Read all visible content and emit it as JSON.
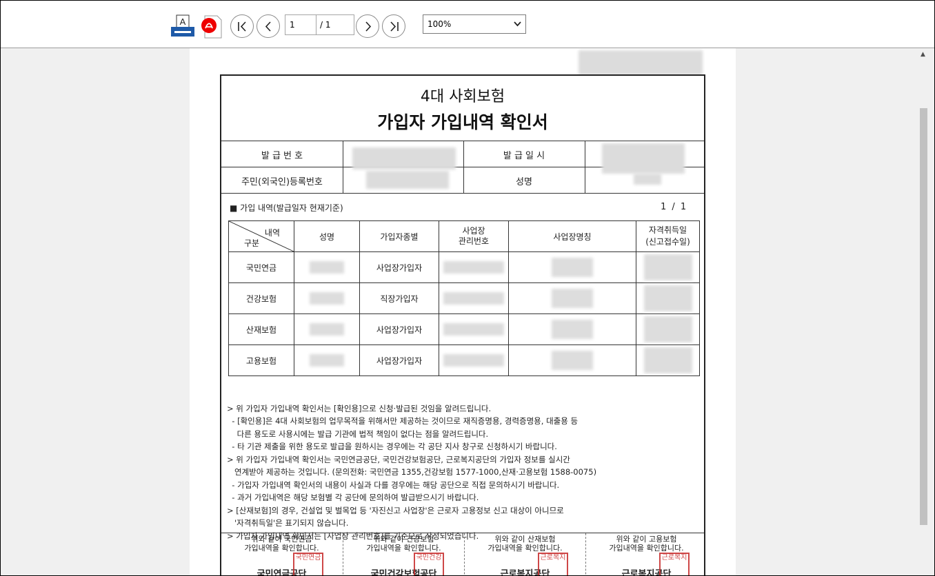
{
  "toolbar": {
    "page_current": "1",
    "page_total": "/ 1",
    "zoom": "100%",
    "icons": [
      "print-text-icon",
      "pdf-icon",
      "first-page-icon",
      "prev-page-icon",
      "next-page-icon",
      "last-page-icon"
    ]
  },
  "doc": {
    "title_line1": "4대 사회보험",
    "title_line2": "가입자 가입내역 확인서",
    "issue_no_label": "발 급 번 호",
    "issue_date_label": "발 급 일 시",
    "reg_no_label": "주민(외국인)등록번호",
    "name_label": "성명",
    "section_title": "■ 가입 내역(발급일자 현재기준)",
    "page_indicator": "1 / 1",
    "table": {
      "corner_top": "내역",
      "corner_bottom": "구분",
      "headers": [
        "성명",
        "가입자종별",
        "사업장\n관리번호",
        "사업장명칭",
        "자격취득일\n(신고접수일)"
      ],
      "rows": [
        {
          "category": "국민연금",
          "type": "사업장가입자"
        },
        {
          "category": "건강보험",
          "type": "직장가입자"
        },
        {
          "category": "산재보험",
          "type": "사업장가입자"
        },
        {
          "category": "고용보험",
          "type": "사업장가입자"
        }
      ]
    },
    "notes": [
      "> 위 가입자 가입내역 확인서는 [확인용]으로 신청·발급된 것임을 알려드립니다.",
      "  - [확인용]은 4대 사회보험의 업무목적을 위해서만 제공하는 것이므로 재직증명용, 경력증명용, 대출용 등",
      "    다른 용도로 사용시에는 발급 기관에 법적 책임이 없다는 점을 알려드립니다.",
      "  - 타 기관 제출을 위한 용도로 발급을 원하시는 경우에는 각 공단 지사 창구로 신청하시기 바랍니다.",
      "> 위 가입자 가입내역 확인서는 국민연금공단, 국민건강보험공단, 근로복지공단의 가입자 정보를 실시간",
      "   연계받아 제공하는 것입니다. (문의전화: 국민연금 1355,건강보험 1577-1000,산재·고용보험 1588-0075)",
      "  - 가입자 가입내역 확인서의 내용이 사실과 다를 경우에는 해당 공단으로 직접 문의하시기 바랍니다.",
      "  - 과거 가입내역은 해당 보험별 각 공단에 문의하여 발급받으시기 바랍니다.",
      "> [산재보험]의 경우, 건설업 및 벌목업 등 '자진신고 사업장'은 근로자 고용정보 신고 대상이 아니므로",
      "   '자격취득일'은 표기되지 않습니다.",
      "> 가입자 가입내역 확인서는 [사업장 관리번호]를 기준으로 작성되었습니다."
    ],
    "stamps": [
      {
        "text": "위와 같이 국민연금\n가입내역을 확인합니다.",
        "org": "국민연금공단",
        "seal": "국민연금"
      },
      {
        "text": "위와 같이 건강보험\n가입내역을 확인합니다.",
        "org": "국민건강보험공단",
        "seal": "국민건강"
      },
      {
        "text": "위와 같이 산재보험\n가입내역을 확인합니다.",
        "org": "근로복지공단",
        "seal": "근로복지"
      },
      {
        "text": "위와 같이 고용보험\n가입내역을 확인합니다.",
        "org": "근로복지공단",
        "seal": "근로복지"
      }
    ]
  }
}
